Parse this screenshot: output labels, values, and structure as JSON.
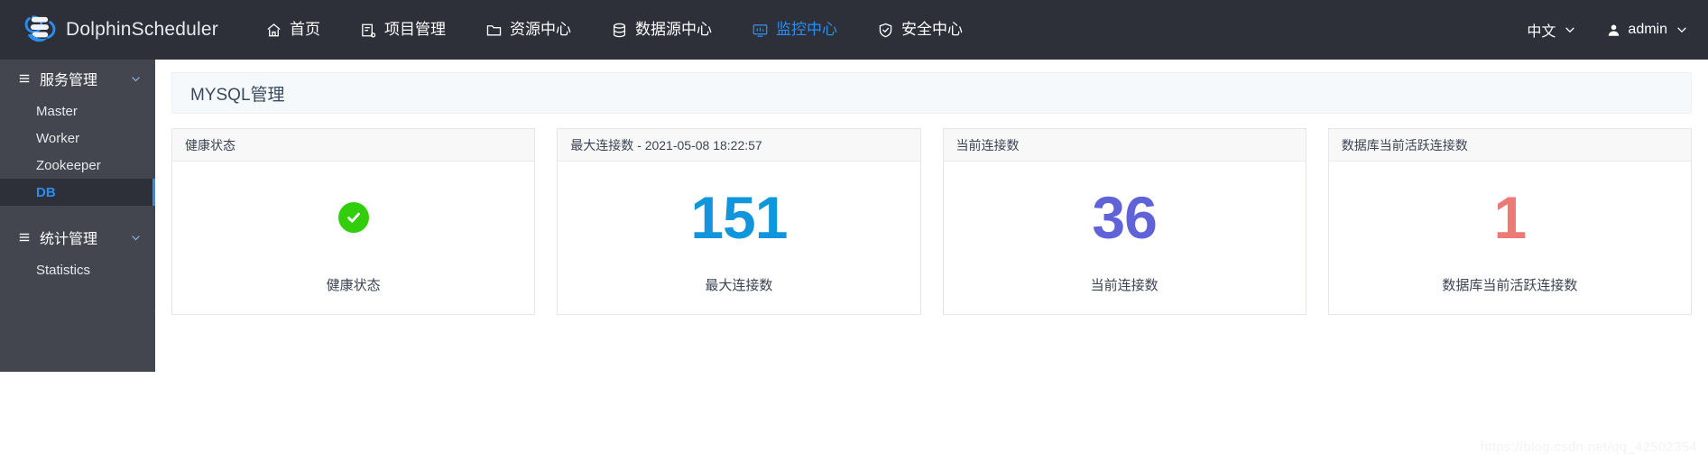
{
  "header": {
    "brand": {
      "logo_icon": "dolphin-logo-icon",
      "name": "DolphinScheduler"
    },
    "nav_items": [
      {
        "icon": "home-icon",
        "label": "首页",
        "active": false
      },
      {
        "icon": "project-icon",
        "label": "项目管理",
        "active": false
      },
      {
        "icon": "folder-icon",
        "label": "资源中心",
        "active": false
      },
      {
        "icon": "database-icon",
        "label": "数据源中心",
        "active": false
      },
      {
        "icon": "monitor-icon",
        "label": "监控中心",
        "active": true
      },
      {
        "icon": "shield-check-icon",
        "label": "安全中心",
        "active": false
      }
    ],
    "language": {
      "label": "中文",
      "icon": "chevron-down-icon"
    },
    "user": {
      "icon": "user-icon",
      "label": "admin",
      "chevron": "chevron-down-icon"
    }
  },
  "sidebar": {
    "groups": [
      {
        "title": "服务管理",
        "icon": "menu-lines-icon",
        "chevron": "chevron-down-icon",
        "items": [
          {
            "label": "Master",
            "active": false
          },
          {
            "label": "Worker",
            "active": false
          },
          {
            "label": "Zookeeper",
            "active": false
          },
          {
            "label": "DB",
            "active": true
          }
        ]
      },
      {
        "title": "统计管理",
        "icon": "menu-lines-icon",
        "chevron": "chevron-down-icon",
        "items": [
          {
            "label": "Statistics",
            "active": false
          }
        ]
      }
    ],
    "collapse_handle": "‹"
  },
  "main": {
    "page_title": "MYSQL管理",
    "cards": [
      {
        "header": "健康状态",
        "value": "",
        "value_type": "status-ok",
        "label": "健康状态",
        "color": "#32cd0b"
      },
      {
        "header": "最大连接数 - 2021-05-08 18:22:57",
        "value": "151",
        "value_type": "number",
        "label": "最大连接数",
        "color": "#1296db"
      },
      {
        "header": "当前连接数",
        "value": "36",
        "value_type": "number",
        "label": "当前连接数",
        "color": "#6063d8"
      },
      {
        "header": "数据库当前活跃连接数",
        "value": "1",
        "value_type": "number",
        "label": "数据库当前活跃连接数",
        "color": "#ec7a77"
      }
    ]
  },
  "watermark": "https://blog.csdn.net/qq_42502354"
}
